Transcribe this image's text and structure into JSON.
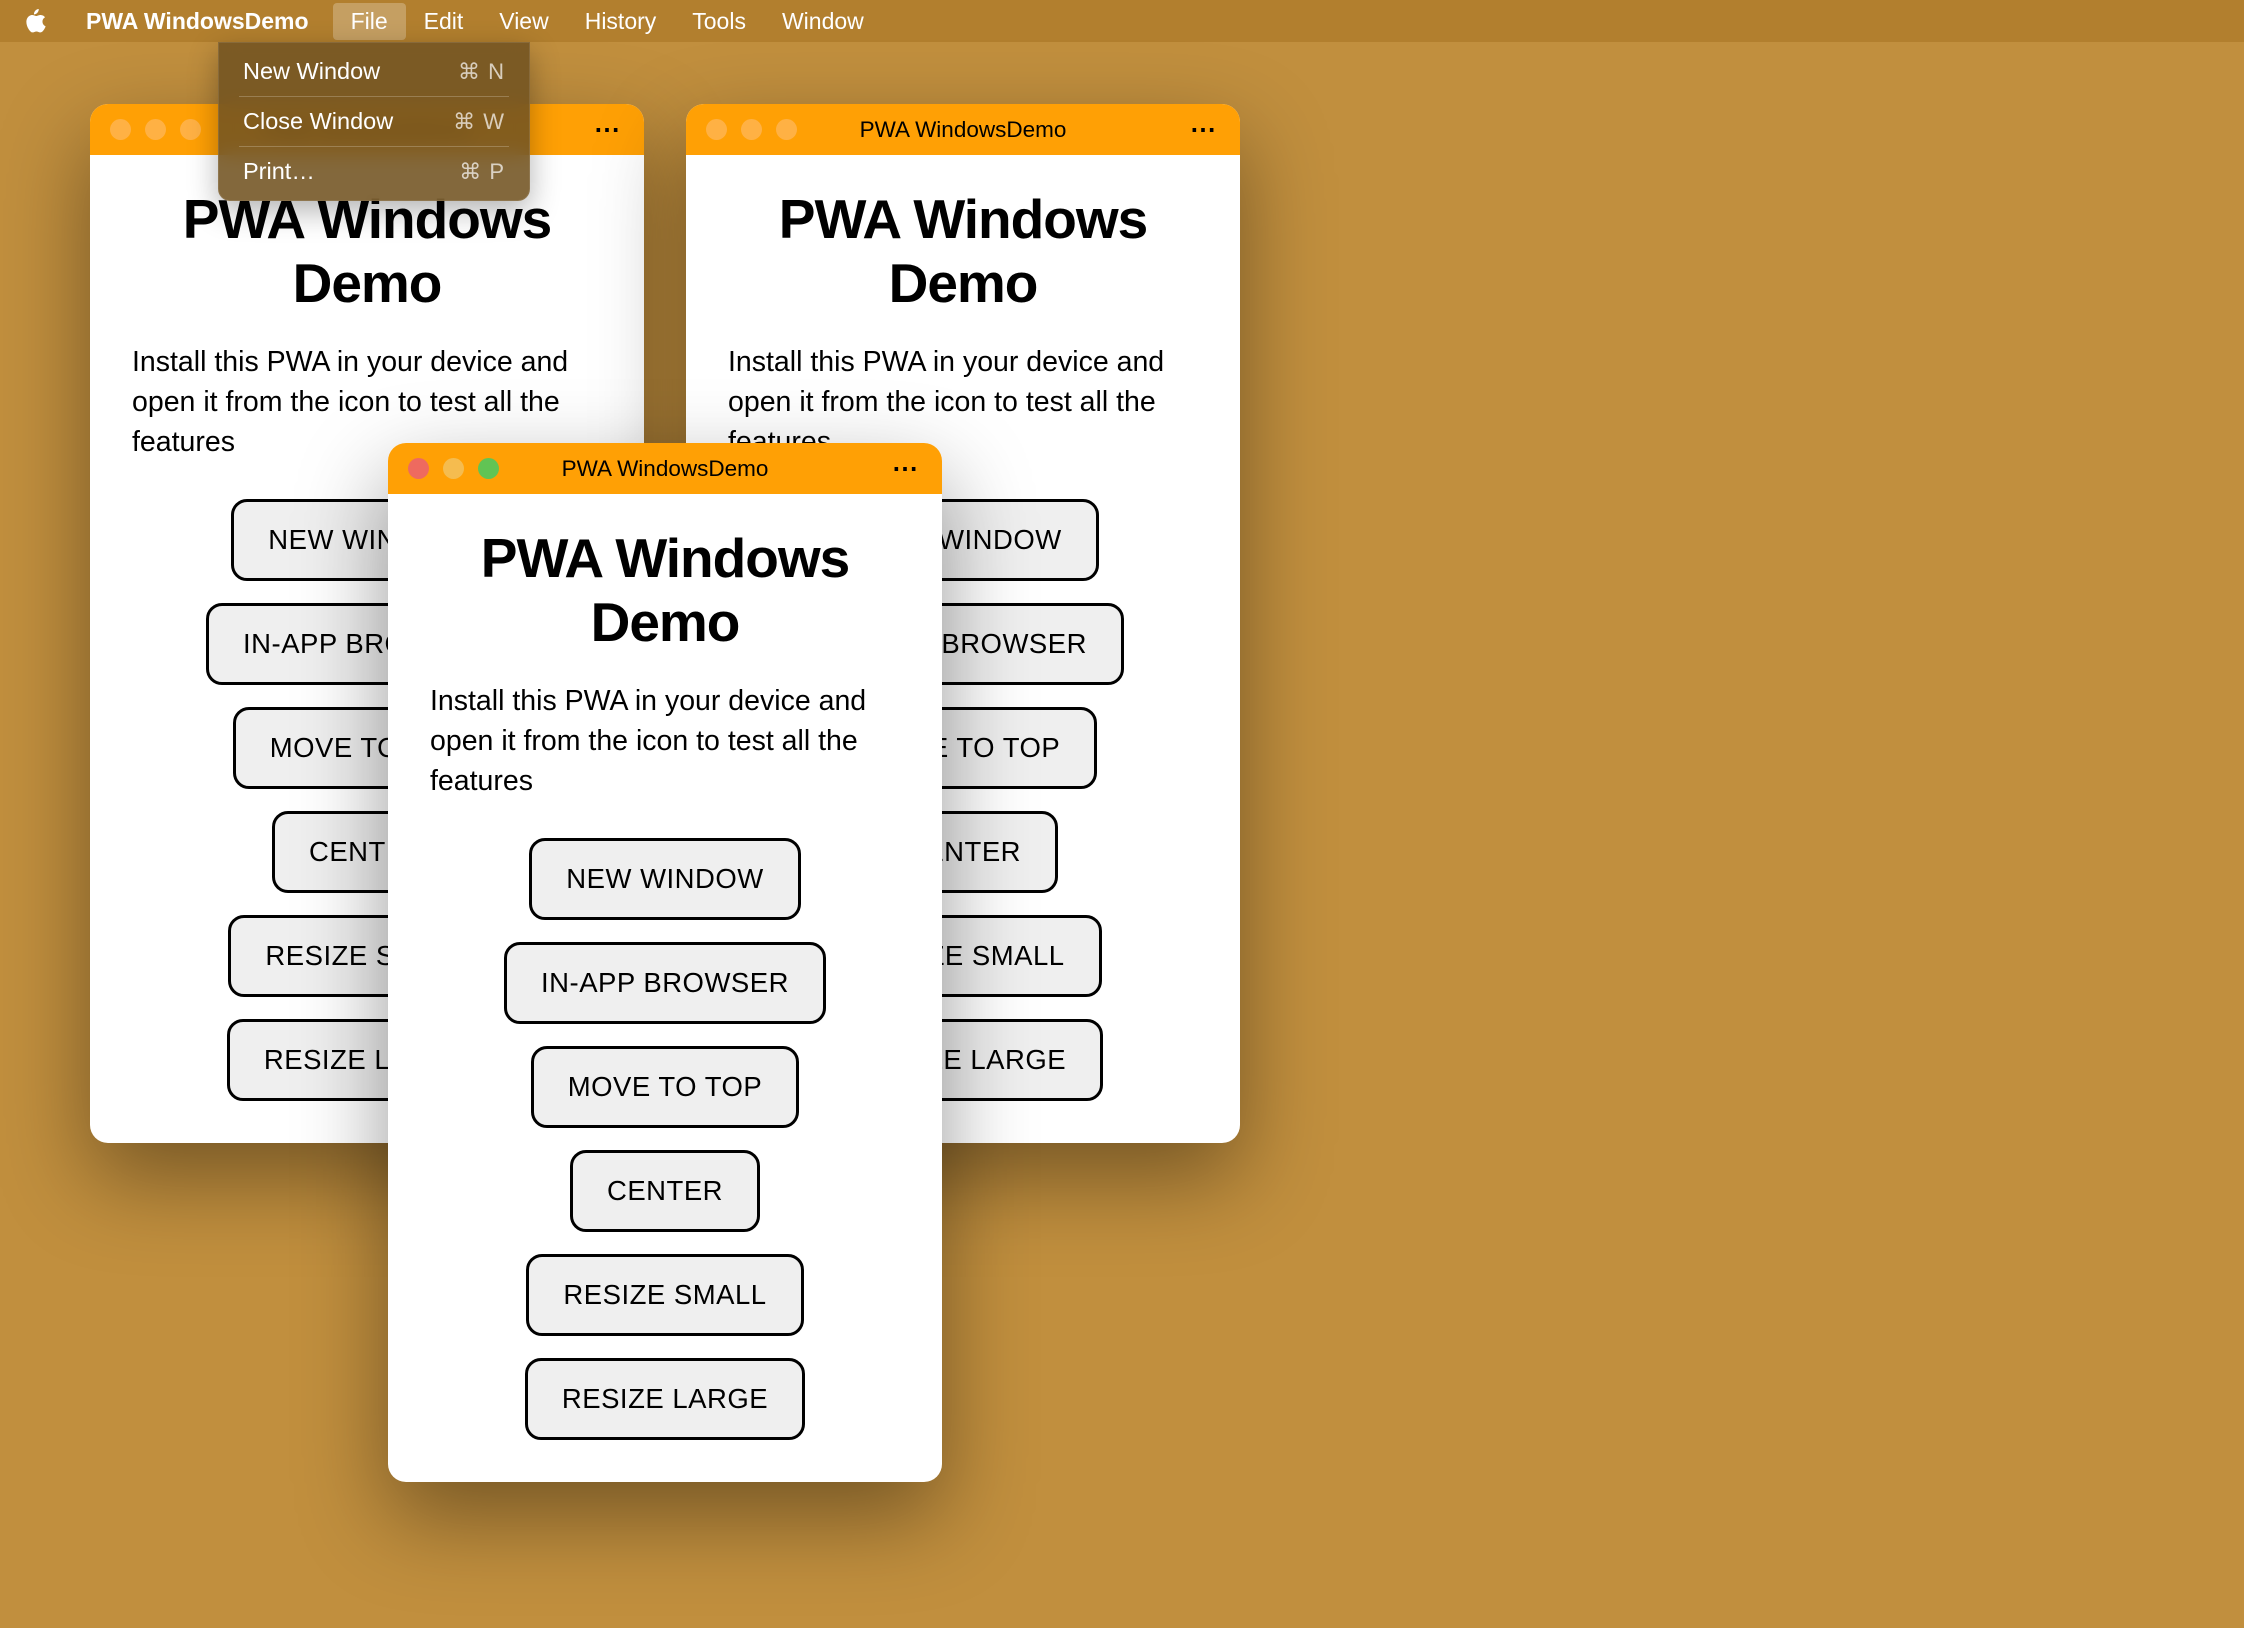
{
  "menubar": {
    "app_name": "PWA WindowsDemo",
    "items": [
      "File",
      "Edit",
      "View",
      "History",
      "Tools",
      "Window"
    ],
    "active_index": 0
  },
  "dropdown": {
    "items": [
      {
        "label": "New Window",
        "shortcut": "⌘ N"
      },
      {
        "label": "Close Window",
        "shortcut": "⌘ W"
      },
      {
        "label": "Print…",
        "shortcut": "⌘ P"
      }
    ]
  },
  "app": {
    "window_title": "PWA WindowsDemo",
    "heading": "PWA Windows Demo",
    "description": "Install this PWA in your device and open it from the icon to test all the features",
    "buttons": [
      "NEW WINDOW",
      "IN-APP BROWSER",
      "MOVE TO TOP",
      "CENTER",
      "RESIZE SMALL",
      "RESIZE LARGE"
    ]
  },
  "windows": [
    {
      "id": "window-1",
      "focused": false
    },
    {
      "id": "window-2",
      "focused": false
    },
    {
      "id": "window-3",
      "focused": true
    }
  ]
}
